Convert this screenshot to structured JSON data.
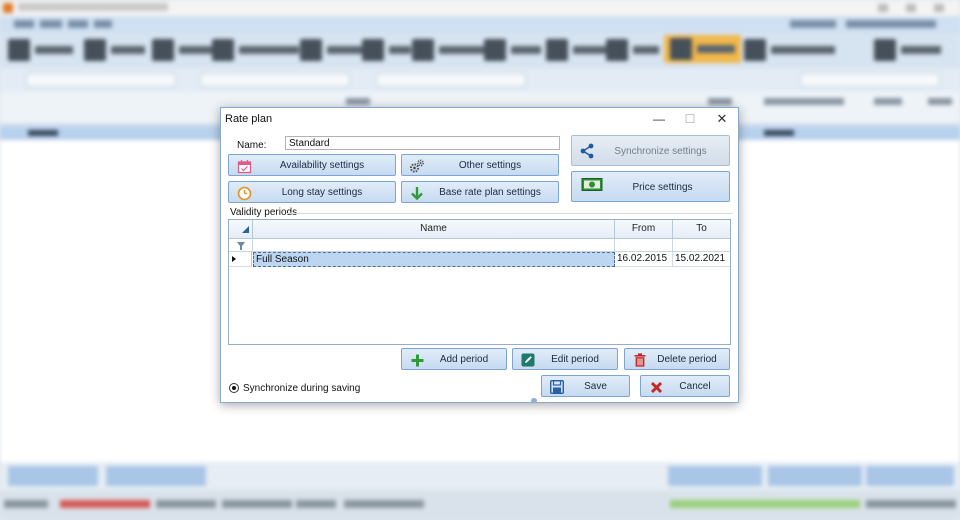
{
  "dialog": {
    "title": "Rate plan",
    "window_controls": {
      "minimize": "—",
      "maximize": "☐",
      "close": "✕"
    },
    "name_label": "Name:",
    "name_value": "Standard",
    "buttons": {
      "availability": "Availability settings",
      "other": "Other settings",
      "synchronize": "Synchronize settings",
      "long_stay": "Long stay settings",
      "base_rate": "Base rate plan settings",
      "price": "Price settings",
      "add_period": "Add period",
      "edit_period": "Edit period",
      "delete_period": "Delete period",
      "save": "Save",
      "cancel": "Cancel"
    },
    "validity_label": "Validity periods",
    "grid": {
      "columns": [
        "Name",
        "From",
        "To"
      ],
      "rows": [
        {
          "name": "Full Season",
          "from": "16.02.2015",
          "to": "15.02.2021"
        }
      ]
    },
    "sync_during_saving": "Synchronize during saving"
  },
  "icons": {
    "availability": "calendar-icon",
    "other": "gears-icon",
    "synchronize": "share-icon",
    "long_stay": "clock-icon",
    "base_rate": "arrow-down-icon",
    "price": "banknote-icon",
    "add_period": "plus-icon",
    "edit_period": "pencil-icon",
    "delete_period": "trash-icon",
    "save": "floppy-icon",
    "cancel": "x-icon"
  },
  "colors": {
    "button_top": "#e1ecf8",
    "button_bottom": "#c6daf1",
    "button_border": "#7da5d2",
    "selection": "#bcd6f2",
    "green": "#2f9a3b",
    "red": "#c62828"
  }
}
